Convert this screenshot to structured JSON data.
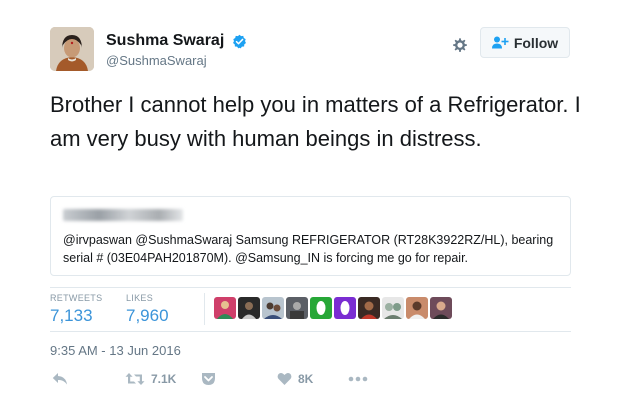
{
  "user": {
    "display_name": "Sushma Swaraj",
    "handle": "@SushmaSwaraj",
    "verified": true
  },
  "header": {
    "follow_label": "Follow",
    "settings_icon": "gear-icon",
    "follow_icon": "person-plus-icon"
  },
  "tweet": {
    "text": "Brother I cannot help you in matters of a Refrigerator. I am very busy with human beings in distress."
  },
  "quote": {
    "author": "blurred",
    "text": "@irvpaswan @SushmaSwaraj Samsung REFRIGERATOR (RT28K3922RZ/HL), bearing serial # (03E04PAH201870M). @Samsung_IN is forcing me go for repair."
  },
  "stats": {
    "retweets_label": "RETWEETS",
    "retweets_value": "7,133",
    "likes_label": "LIKES",
    "likes_value": "7,960",
    "likers_count": 10
  },
  "timestamp": "9:35 AM - 13 Jun 2016",
  "actions": {
    "reply_icon": "reply-icon",
    "retweet_icon": "retweet-icon",
    "retweet_count": "7.1K",
    "save_icon": "pocket-icon",
    "like_icon": "heart-icon",
    "like_count": "8K",
    "more_icon": "more-dots-icon"
  },
  "colors": {
    "link_blue": "#3b94d9",
    "verified_blue": "#1da1f2",
    "muted": "#657786",
    "action_gray": "#aab8c2",
    "green_avatar": "#27a737",
    "purple_avatar": "#7a2dd2"
  }
}
